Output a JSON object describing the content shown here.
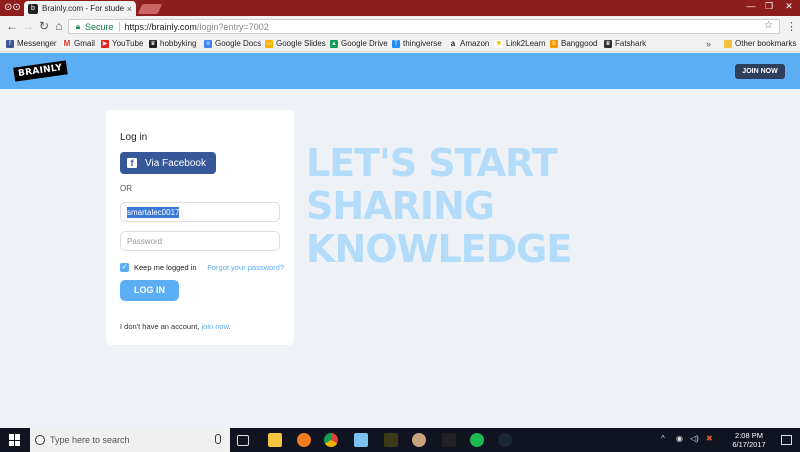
{
  "browser": {
    "tab_title": "Brainly.com - For studen",
    "tab_favicon": "b",
    "close_glyph": "×",
    "secure_label": "Secure",
    "url_base": "https://brainly.com",
    "url_path": "/login?entry=7002"
  },
  "bookmarks": [
    {
      "label": "Messenger",
      "icon": "facebook-icon",
      "color": "#3b5998"
    },
    {
      "label": "Gmail",
      "icon": "gmail-icon",
      "color": "#d93025"
    },
    {
      "label": "YouTube",
      "icon": "youtube-icon",
      "color": "#e62117"
    },
    {
      "label": "hobbyking",
      "icon": "hobbyking-icon",
      "color": "#222222"
    },
    {
      "label": "Google Docs",
      "icon": "docs-icon",
      "color": "#4285f4"
    },
    {
      "label": "Google Slides",
      "icon": "slides-icon",
      "color": "#f4b400"
    },
    {
      "label": "Google Drive",
      "icon": "drive-icon",
      "color": "#0f9d58"
    },
    {
      "label": "thingiverse",
      "icon": "thingiverse-icon",
      "color": "#248bfb"
    },
    {
      "label": "Amazon",
      "icon": "amazon-icon",
      "color": "#222222"
    },
    {
      "label": "Link2Learn",
      "icon": "link2learn-icon",
      "color": "#f2c200"
    },
    {
      "label": "Banggood",
      "icon": "banggood-icon",
      "color": "#f39800"
    },
    {
      "label": "Fatshark",
      "icon": "fatshark-icon",
      "color": "#333333"
    }
  ],
  "bookmarks_more": "»",
  "other_bookmarks": "Other bookmarks",
  "site": {
    "logo": "BRAINLY",
    "join_now": "JOIN NOW"
  },
  "login": {
    "title": "Log in",
    "facebook_label": "Via Facebook",
    "or_label": "OR",
    "username_value": "smartalec0017",
    "password_placeholder": "Password",
    "keep_logged_in": "Keep me logged in",
    "forgot_password": "Forgot your password?",
    "login_button": "LOG IN",
    "signup_text": "I don't have an account, ",
    "signup_link": "join now",
    "signup_end": "."
  },
  "hero": {
    "line1": "LET'S START",
    "line2": "SHARING",
    "line3": "KNOWLEDGE"
  },
  "taskbar": {
    "search_placeholder": "Type here to search",
    "time": "2:08 PM",
    "date": "6/17/2017"
  },
  "colors": {
    "brand_blue": "#5caef4",
    "facebook_blue": "#365899",
    "title_bar_red": "#8e1d1d"
  }
}
